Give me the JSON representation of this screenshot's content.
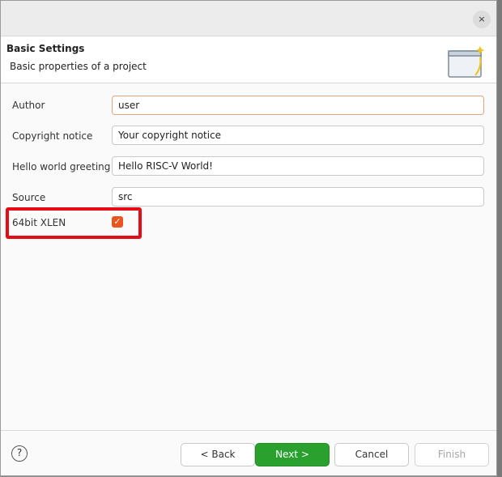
{
  "header": {
    "title": "Basic Settings",
    "subtitle": "Basic properties of a project"
  },
  "window": {
    "close_label": "×"
  },
  "form": {
    "author": {
      "label": "Author",
      "value": "user"
    },
    "copyright": {
      "label": "Copyright notice",
      "value": "Your copyright notice"
    },
    "greeting": {
      "label": "Hello world greeting",
      "value": "Hello RISC-V World!"
    },
    "source": {
      "label": "Source",
      "value": "src"
    },
    "xlen": {
      "label": "64bit XLEN",
      "checked": true,
      "check_glyph": "✓"
    }
  },
  "footer": {
    "help_glyph": "?",
    "back_label": "< Back",
    "next_label": "Next >",
    "cancel_label": "Cancel",
    "finish_label": "Finish"
  },
  "colors": {
    "accent_green": "#2aa12f",
    "checkbox_orange": "#e9541f",
    "highlight_red": "#e40d17"
  }
}
